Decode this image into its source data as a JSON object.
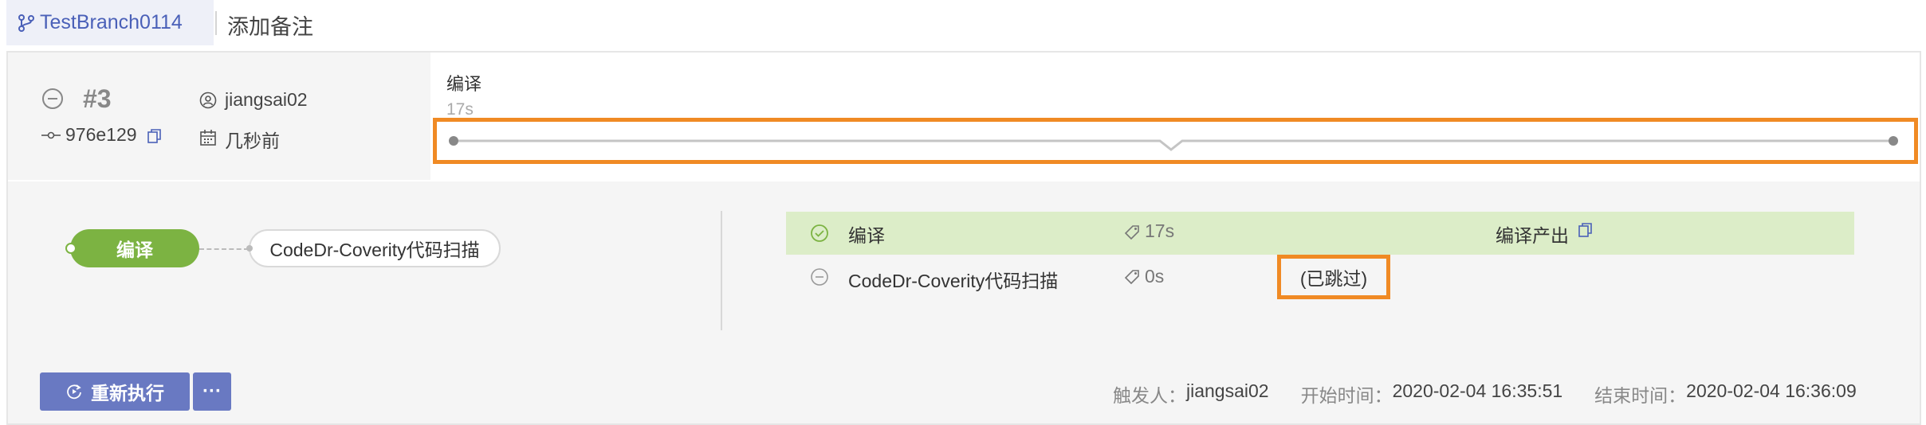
{
  "header": {
    "branch_name": "TestBranch0114",
    "note_link": "添加备注"
  },
  "build": {
    "number": "#3",
    "user": "jiangsai02",
    "commit": "976e129",
    "time_ago": "几秒前"
  },
  "timeline": {
    "stage_title": "编译",
    "stage_duration": "17s"
  },
  "pipeline": {
    "stage1": "编译",
    "stage2": "CodeDr-Coverity代码扫描"
  },
  "jobs": [
    {
      "name": "编译",
      "duration": "17s",
      "extra": "编译产出",
      "status": "success"
    },
    {
      "name": "CodeDr-Coverity代码扫描",
      "duration": "0s",
      "extra": "(已跳过)",
      "status": "skipped"
    }
  ],
  "footer": {
    "rerun_label": "重新执行",
    "more_label": "···",
    "trigger_label": "触发人：",
    "trigger_value": "jiangsai02",
    "start_label": "开始时间：",
    "start_value": "2020-02-04 16:35:51",
    "end_label": "结束时间：",
    "end_value": "2020-02-04 16:36:09"
  },
  "colors": {
    "accent": "#6979c2",
    "success": "#7cb342",
    "success_bg": "#dcedc8",
    "highlight": "#f08a24",
    "branch_link": "#4a60b8"
  }
}
